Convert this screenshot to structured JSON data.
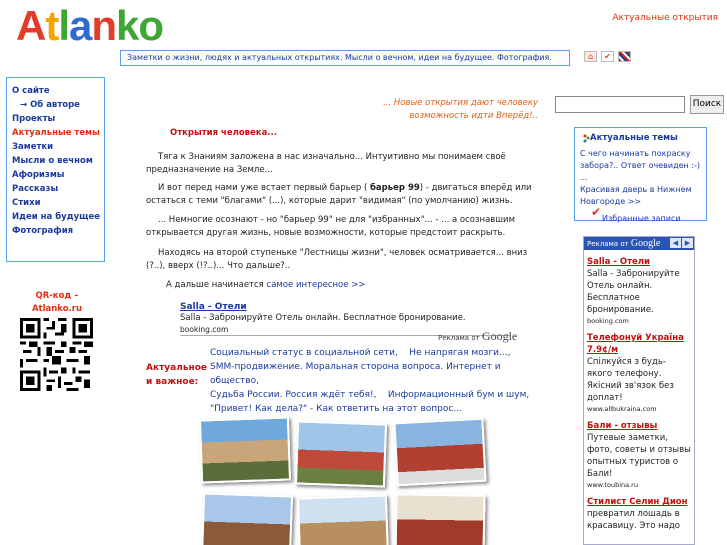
{
  "header": {
    "logo": [
      "A",
      "t",
      "l",
      "a",
      "n",
      "ko"
    ],
    "top_link": "Актуальные открытия",
    "tagline": "Заметки о жизни, людях и актуальных открытиях. Мысли о вечном, идеи на будущее. Фотография."
  },
  "menu": {
    "items": [
      {
        "label": "О сайте"
      },
      {
        "label": "→ Об авторе"
      },
      {
        "label": "Проекты"
      },
      {
        "label": "Актуальные темы"
      },
      {
        "label": "Заметки"
      },
      {
        "label": "Мысли о вечном"
      },
      {
        "label": "Афоризмы"
      },
      {
        "label": "Рассказы"
      },
      {
        "label": "Стихи"
      },
      {
        "label": "Идеи на будущее"
      },
      {
        "label": "Фотография"
      }
    ]
  },
  "qr": {
    "label_line1": "QR-код –",
    "label_line2": "Atlanko.ru"
  },
  "main": {
    "quote": "... Новые открытия дают человеку возможность идти Вперёд!..",
    "title": "Открытия человека...",
    "p1": "Тяга к Знаниям заложена в нас изначально... Интуитивно мы понимаем своё предназначение на Земле...",
    "p2a": "И вот перед нами уже встает первый барьер (",
    "p2b": "барьер 99",
    "p2c": ") - двигаться вперёд или остаться с теми \"благами\" (...), которые дарит \"видимая\" (по умолчанию) жизнь.",
    "p3": "... Немногие осознают - но \"барьер 99\" не для \"избранных\"... - ... а осознавшим открывается другая жизнь, новые возможности, которые предстоит раскрыть.",
    "p4": "Находясь на второй ступеньке \"Лестницы жизни\", человек осматривается... вниз (?..), вверх (!?..)... Что дальше?..",
    "more_text": "А дальше начинается",
    "more_link": "самое интересное >>"
  },
  "ad_inline": {
    "title": "Salla - Отели",
    "desc": "Salla - Забронируйте Отель онлайн. Бесплатное бронирование.",
    "url": "booking.com",
    "ads_by": "Реклама от",
    "google": "Google"
  },
  "actual": {
    "label_line1": "Актуальное",
    "label_line2": "и важное:",
    "links": [
      "Социальный статус в социальной сети,",
      "Не напрягая мозги...,",
      "SMM-продвижение. Моральная сторона вопроса. Интернет и общество,",
      "Судьба России. Россия ждёт тебя!,",
      "Информационный бум и шум,",
      "\"Привет! Как дела?\" - Как ответить на этот вопрос..."
    ]
  },
  "search": {
    "placeholder": "",
    "button": "Поиск"
  },
  "side_box": {
    "title": "Актуальные темы",
    "link1": "С чего начинать покраску забора?.. Ответ очевиден :-) ...",
    "link2": "Красивая дверь в Нижнем Новгороде >>",
    "favorites": "Избранные записи"
  },
  "google_ads": {
    "head": "Реклама от",
    "google": "Google",
    "ads": [
      {
        "title": "Salla - Отели",
        "desc": "Salla - Забронируйте Отель онлайн. Бесплатное бронирование.",
        "url": "booking.com"
      },
      {
        "title": "Телефонуй Україна",
        "price": "7.9¢/м",
        "desc": "Спілкуйся з будь-якого телефону. Якісний зв'язок без доплат!",
        "url": "www.allbukraina.com"
      },
      {
        "title": "Бали - отзывы",
        "desc": "Путевые заметки, фото, советы и отзывы опытных туристов о Бали!",
        "url": "www.toubina.ru"
      },
      {
        "title": "Стилист Селин Дион",
        "desc": "превратил лошадь в красавицу. Это надо"
      }
    ]
  },
  "colors": {
    "accent_blue": "#1a3a9e",
    "accent_red": "#e03010",
    "border_blue": "#5aa0e8"
  }
}
